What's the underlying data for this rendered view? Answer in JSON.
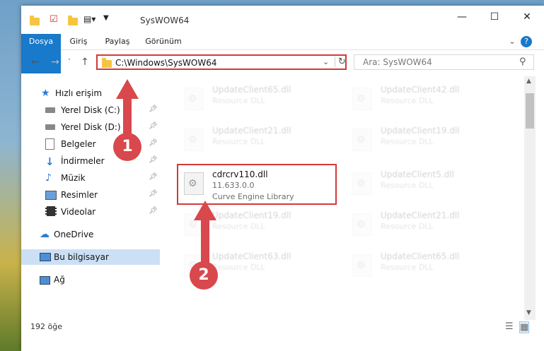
{
  "window": {
    "title": "SysWOW64",
    "controls": {
      "minimize": "—",
      "maximize": "☐",
      "close": "✕"
    }
  },
  "ribbon": {
    "tabs": [
      {
        "label": "Dosya"
      },
      {
        "label": "Giriş"
      },
      {
        "label": "Paylaş"
      },
      {
        "label": "Görünüm"
      }
    ],
    "help": "?"
  },
  "navbar": {
    "address": "C:\\Windows\\SysWOW64",
    "search_placeholder": "Ara: SysWOW64"
  },
  "sidebar": {
    "items": [
      {
        "label": "Hızlı erişim",
        "pinned": false
      },
      {
        "label": "Yerel Disk (C:)",
        "pinned": true
      },
      {
        "label": "Yerel Disk (D:)",
        "pinned": true
      },
      {
        "label": "Belgeler",
        "pinned": true
      },
      {
        "label": "İndirmeler",
        "pinned": true
      },
      {
        "label": "Müzik",
        "pinned": true
      },
      {
        "label": "Resimler",
        "pinned": true
      },
      {
        "label": "Videolar",
        "pinned": true
      },
      {
        "label": "OneDrive",
        "pinned": false
      },
      {
        "label": "Bu bilgisayar",
        "pinned": false,
        "selected": true
      },
      {
        "label": "Ağ",
        "pinned": false
      }
    ]
  },
  "files": [
    {
      "name": "UpdateClient65.dll",
      "desc": "Resource DLL"
    },
    {
      "name": "UpdateClient42.dll",
      "desc": "Resource DLL"
    },
    {
      "name": "UpdateClient21.dll",
      "desc": "Resource DLL"
    },
    {
      "name": "UpdateClient19.dll",
      "desc": "Resource DLL"
    },
    {
      "name": "cdrcrv110.dll",
      "version": "11.633.0.0",
      "desc": "Curve Engine Library"
    },
    {
      "name": "UpdateClient5.dll",
      "desc": "Resource DLL"
    },
    {
      "name": "UpdateClient19.dll",
      "desc": "Resource DLL"
    },
    {
      "name": "UpdateClient21.dll",
      "desc": "Resource DLL"
    },
    {
      "name": "UpdateClient63.dll",
      "desc": "Resource DLL"
    },
    {
      "name": "UpdateClient65.dll",
      "desc": "Resource DLL"
    }
  ],
  "status": {
    "count": "192 öğe"
  },
  "annotations": {
    "step1": "1",
    "step2": "2"
  },
  "colors": {
    "accent": "#1979ca",
    "highlight": "#d23a3a",
    "badge": "#d8484c"
  }
}
